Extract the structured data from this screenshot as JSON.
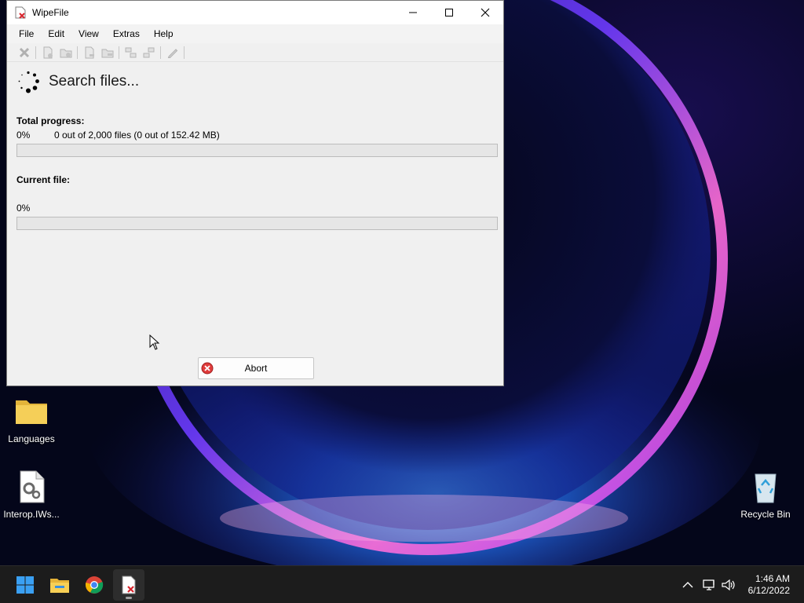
{
  "window": {
    "title": "WipeFile",
    "menu": [
      "File",
      "Edit",
      "View",
      "Extras",
      "Help"
    ],
    "search_heading": "Search files...",
    "total_progress": {
      "label": "Total progress:",
      "percent_text": "0%",
      "count_text": "0 out of 2,000 files (0 out of 152.42 MB)",
      "value": 0
    },
    "current_file": {
      "label": "Current file:",
      "percent_text": "0%",
      "value": 0
    },
    "abort_label": "Abort"
  },
  "desktop": {
    "icons": [
      "Languages",
      "Interop.IWs...",
      "Recycle Bin"
    ]
  },
  "taskbar": {
    "apps": [
      "start-icon",
      "file-explorer-icon",
      "chrome-icon",
      "wipefile-icon"
    ],
    "time": "1:46 AM",
    "date": "6/12/2022"
  },
  "colors": {
    "progress_fill": "#06b025",
    "abort_icon": "#e03c3c"
  }
}
